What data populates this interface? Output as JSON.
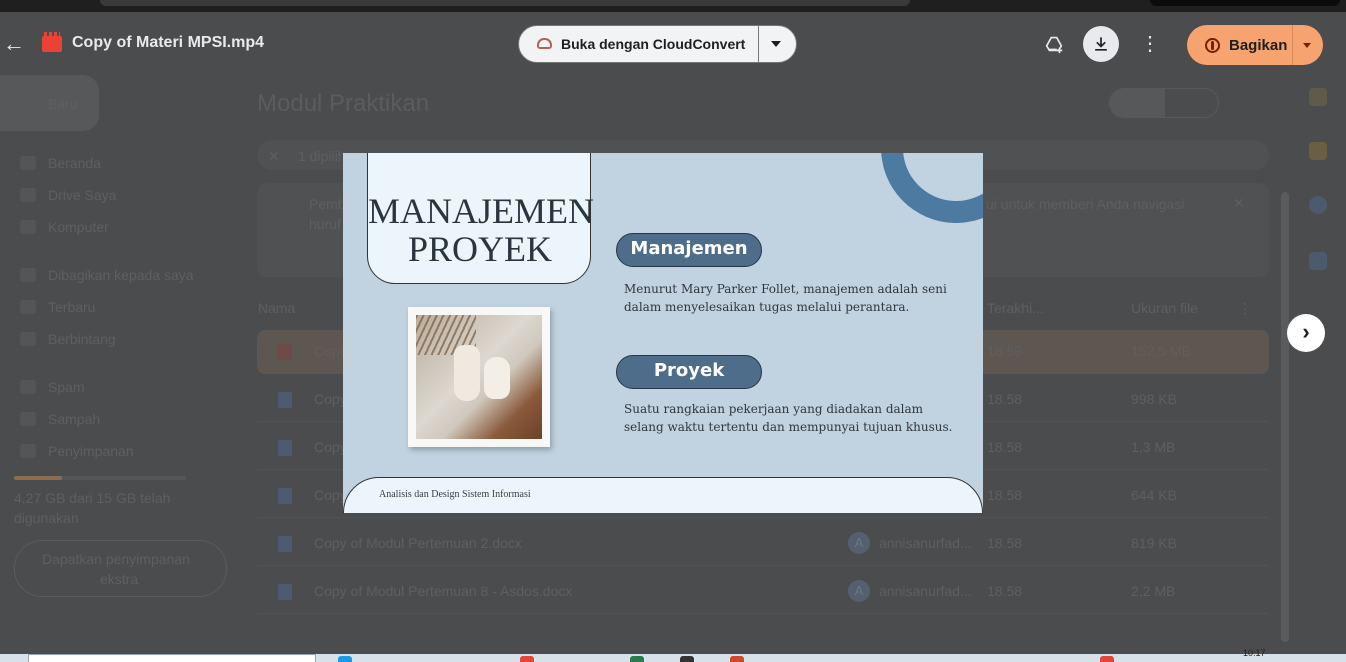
{
  "viewer": {
    "file_title": "Copy of Materi MPSI.mp4",
    "open_with_label": "Buka dengan CloudConvert",
    "share_label": "Bagikan",
    "icons": {
      "back": "arrow-left-icon",
      "file_type": "video-file-icon",
      "open_with": "cloudconvert-icon",
      "add_to_drive": "add-to-drive-icon",
      "download": "download-icon",
      "more": "more-vertical-icon",
      "share": "globe-icon",
      "next": "chevron-right-icon"
    },
    "colors": {
      "share_button": "#f6a36f",
      "file_icon": "#ea4335"
    }
  },
  "slide": {
    "title_line1": "MANAJEMEN",
    "title_line2": "PROYEK",
    "section1_heading": "Manajemen",
    "section1_text": "Menurut Mary Parker Follet, manajemen adalah seni dalam menyelesaikan tugas melalui perantara.",
    "section2_heading": "Proyek",
    "section2_text": "Suatu rangkaian pekerjaan yang diadakan dalam selang waktu tertentu dan mempunyai tujuan khusus.",
    "footer": "Analisis dan Design Sistem Informasi",
    "colors": {
      "background": "#c1d2e0",
      "accent": "#4e6d8a"
    }
  },
  "drive_background": {
    "new_button": "Baru",
    "page_title": "Modul Praktikan",
    "sidebar": [
      "Beranda",
      "Drive Saya",
      "Komputer",
      "Dibagikan kepada saya",
      "Terbaru",
      "Berbintang",
      "Spam",
      "Sampah",
      "Penyimpanan"
    ],
    "storage_text_line1": "4,27 GB dari 15 GB telah",
    "storage_text_line2": "digunakan",
    "get_storage_line1": "Dapatkan penyimpanan",
    "get_storage_line2": "ekstra",
    "selection_text": "1 dipilih",
    "notice_text_left": "Pemb",
    "notice_text_left2": "huruf",
    "notice_text_right": "ui untuk memberi Anda navigasi",
    "columns": {
      "name": "Nama",
      "modified": "Terakhi...",
      "size": "Ukuran file"
    },
    "rows": [
      {
        "name": "Copy",
        "time": "18.59",
        "size": "152,5 MB"
      },
      {
        "name": "Copy",
        "time": "18.58",
        "size": "998 KB"
      },
      {
        "name": "Copy",
        "time": "18.58",
        "size": "1,3 MB"
      },
      {
        "name": "Copy",
        "time": "18.58",
        "size": "644 KB"
      },
      {
        "name": "Copy of Modul Pertemuan 2.docx",
        "owner": "annisanurfad...",
        "time": "18.58",
        "size": "819 KB"
      },
      {
        "name": "Copy of Modul Pertemuan 8 - Asdos.docx",
        "owner": "annisanurfad...",
        "time": "18.58",
        "size": "2,2 MB"
      }
    ],
    "avatar_letter": "A"
  },
  "taskbar": {
    "clock": "10:17"
  }
}
